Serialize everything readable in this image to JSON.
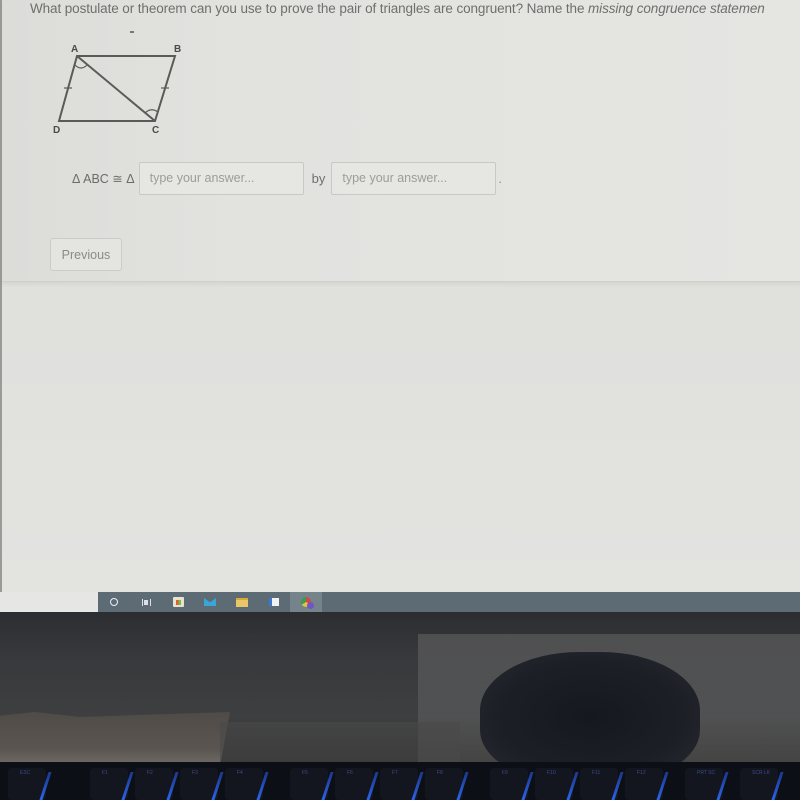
{
  "question": {
    "text_main": "What postulate or theorem can you use to prove the pair of triangles are congruent? Name the ",
    "text_italic": "missing congruence statemen"
  },
  "diagram": {
    "labels": {
      "A": "A",
      "B": "B",
      "C": "C",
      "D": "D"
    },
    "description": "Parallelogram ABCD with diagonal AC; AD and BC marked congruent; angles DAC and BCA marked congruent"
  },
  "answer": {
    "statement": "Δ ABC ≅ Δ",
    "input1_placeholder": "type your answer...",
    "input1_value": "",
    "by_label": "by",
    "input2_placeholder": "type your answer...",
    "input2_value": "",
    "period": "."
  },
  "navigation": {
    "previous_label": "Previous"
  },
  "taskbar": {
    "icons": [
      {
        "name": "cortana-search-icon"
      },
      {
        "name": "task-view-icon"
      },
      {
        "name": "microsoft-store-icon"
      },
      {
        "name": "mail-icon"
      },
      {
        "name": "file-explorer-icon"
      },
      {
        "name": "app-window-icon"
      },
      {
        "name": "chrome-icon",
        "active": true
      }
    ]
  },
  "keyboard": {
    "keys": [
      "ESC",
      "F1",
      "F2",
      "F3",
      "F4",
      "F5",
      "F6",
      "F7",
      "F8",
      "F9",
      "F10",
      "F11",
      "F12",
      "PRT SC",
      "SCR LK"
    ]
  }
}
